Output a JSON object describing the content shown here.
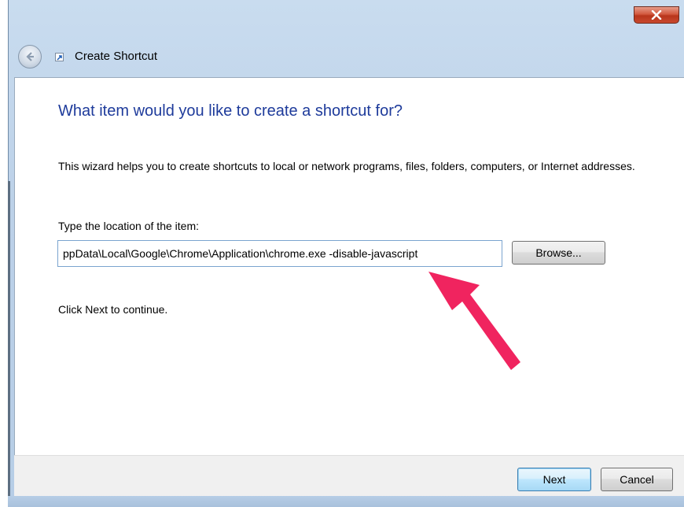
{
  "window": {
    "title": "Create Shortcut",
    "close_symbol": "x"
  },
  "wizard": {
    "heading": "What item would you like to create a shortcut for?",
    "description": "This wizard helps you to create shortcuts to local or network programs, files, folders, computers, or Internet addresses.",
    "location_label": "Type the location of the item:",
    "location_value": "ppData\\Local\\Google\\Chrome\\Application\\chrome.exe -disable-javascript",
    "browse_label": "Browse...",
    "hint": "Click Next to continue."
  },
  "footer": {
    "next_label": "Next",
    "cancel_label": "Cancel"
  },
  "icons": {
    "back": "back-arrow-icon",
    "close": "close-icon",
    "shortcut": "shortcut-icon",
    "annotation": "annotation-arrow"
  },
  "colors": {
    "heading": "#1e3b9b",
    "annotation_arrow": "#f0245f",
    "close_button": "#c8482e"
  }
}
